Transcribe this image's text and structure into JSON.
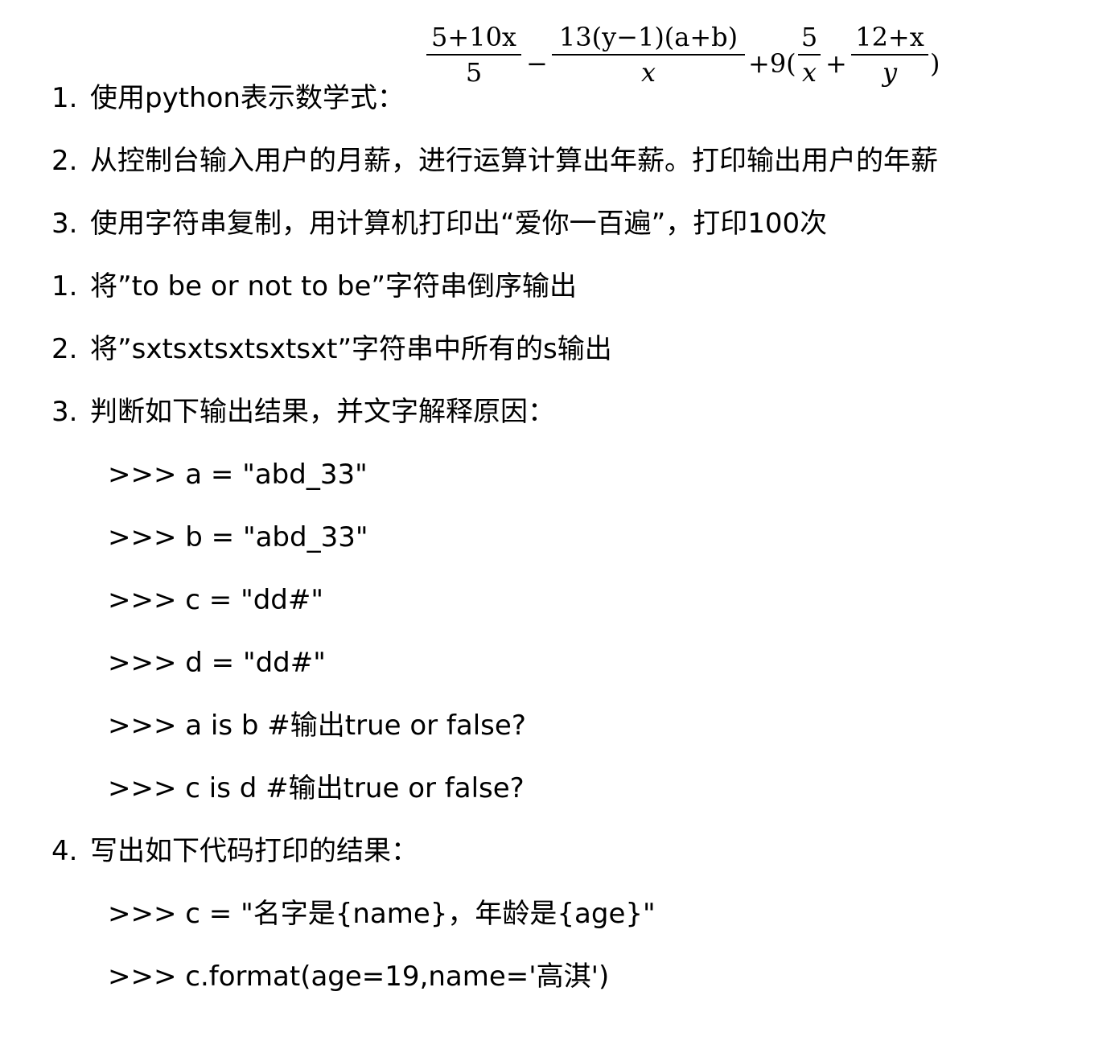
{
  "items": {
    "q1": {
      "num": "1.",
      "text": "使用python表示数学式："
    },
    "q2": {
      "num": "2.",
      "text": "从控制台输入用户的月薪，进行运算计算出年薪。打印输出用户的年薪"
    },
    "q3": {
      "num": "3.",
      "text": "使用字符串复制，用计算机打印出“爱你一百遍”，打印100次"
    },
    "q4": {
      "num": "1.",
      "text": "将”to be or not to be”字符串倒序输出"
    },
    "q5": {
      "num": "2.",
      "text": "将”sxtsxtsxtsxtsxt”字符串中所有的s输出"
    },
    "q6": {
      "num": "3.",
      "text": "判断如下输出结果，并文字解释原因："
    },
    "q7": {
      "num": "4.",
      "text": "写出如下代码打印的结果："
    }
  },
  "code_block_1": [
    ">>> a = \"abd_33\"",
    ">>> b = \"abd_33\"",
    ">>> c = \"dd#\"",
    ">>> d = \"dd#\"",
    ">>> a is b #输出true or false?",
    ">>> c is d #输出true or false?"
  ],
  "code_block_2": [
    ">>> c = \"名字是{name}，年龄是{age}\"",
    ">>> c.format(age=19,name='高淇')"
  ],
  "formula": {
    "f1_num": "5+10x",
    "f1_den": "5",
    "minus": "−",
    "f2_num": "13(y−1)(a+b)",
    "f2_den": "x",
    "plus_nine": "+9(",
    "f3_num": "5",
    "f3_den": "x",
    "plus": "+",
    "f4_num": "12+x",
    "f4_den": "y",
    "close": ")"
  }
}
